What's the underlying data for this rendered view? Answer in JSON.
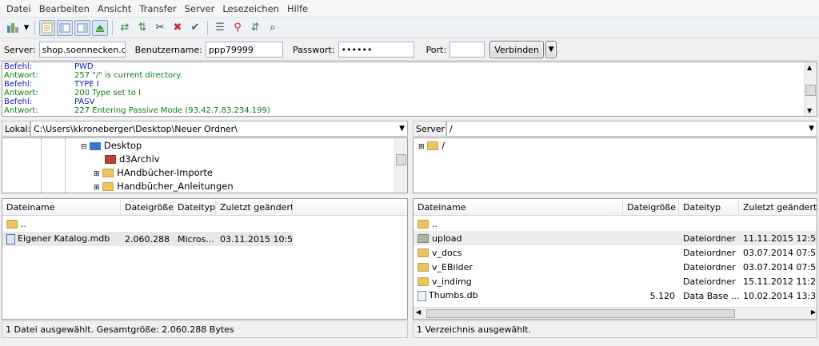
{
  "menu": [
    "Datei",
    "Bearbeiten",
    "Ansicht",
    "Transfer",
    "Server",
    "Lesezeichen",
    "Hilfe"
  ],
  "toolbar_icons": [
    "site-manager",
    "split-view",
    "message-log",
    "local-tree",
    "remote-tree",
    "transfer-queue",
    "refresh",
    "process-queue",
    "cancel",
    "disconnect",
    "reconnect",
    "directory-listing",
    "filter",
    "sync-browse",
    "search"
  ],
  "quickconnect": {
    "server_label": "Server:",
    "server_value": "shop.soennecken.de",
    "user_label": "Benutzername:",
    "user_value": "ppp79999",
    "pass_label": "Passwort:",
    "pass_value": "••••••",
    "port_label": "Port:",
    "port_value": "",
    "connect_label": "Verbinden"
  },
  "log": [
    {
      "key": "Befehl:",
      "val": "PWD",
      "type": "blue"
    },
    {
      "key": "Antwort:",
      "val": "257 \"/\" is current directory.",
      "type": "green"
    },
    {
      "key": "Befehl:",
      "val": "TYPE I",
      "type": "blue"
    },
    {
      "key": "Antwort:",
      "val": "200 Type set to I",
      "type": "green"
    },
    {
      "key": "Befehl:",
      "val": "PASV",
      "type": "blue"
    },
    {
      "key": "Antwort:",
      "val": "227 Entering Passive Mode (93.42.7.83.234.199)",
      "type": "green"
    }
  ],
  "local": {
    "path_label": "Lokal:",
    "path": "C:\\Users\\kkroneberger\\Desktop\\Neuer Ordner\\",
    "tree": [
      "Desktop",
      "d3Archiv",
      "HAndbücher-Importe",
      "Handbücher_Anleitungen"
    ],
    "headers": [
      "Dateiname",
      "Dateigröße",
      "Dateityp",
      "Zuletzt geändert"
    ],
    "rows": [
      {
        "name": "..",
        "size": "",
        "type": "",
        "date": ""
      },
      {
        "name": "Eigener Katalog.mdb",
        "size": "2.060.288",
        "type": "Micros...",
        "date": "03.11.2015 10:5..."
      }
    ],
    "status": "1 Datei ausgewählt. Gesamtgröße: 2.060.288 Bytes"
  },
  "remote": {
    "path_label": "Server:",
    "path": "/",
    "tree": [
      "/"
    ],
    "headers": [
      "Dateiname",
      "Dateigröße",
      "Dateityp",
      "Zuletzt geändert"
    ],
    "rows": [
      {
        "name": "..",
        "size": "",
        "type": "",
        "date": ""
      },
      {
        "name": "upload",
        "size": "",
        "type": "Dateiordner",
        "date": "11.11.2015 12:5..."
      },
      {
        "name": "v_docs",
        "size": "",
        "type": "Dateiordner",
        "date": "03.07.2014 07:5..."
      },
      {
        "name": "v_EBilder",
        "size": "",
        "type": "Dateiordner",
        "date": "03.07.2014 07:5..."
      },
      {
        "name": "v_indimg",
        "size": "",
        "type": "Dateiordner",
        "date": "15.11.2012 11:2..."
      },
      {
        "name": "Thumbs.db",
        "size": "5.120",
        "type": "Data Base ...",
        "date": "10.02.2014 13:3..."
      }
    ],
    "status": "1 Verzeichnis ausgewählt."
  },
  "colors": {
    "command": "#1a14b8",
    "response": "#0b7d0b",
    "selected": "#cde3f7"
  }
}
